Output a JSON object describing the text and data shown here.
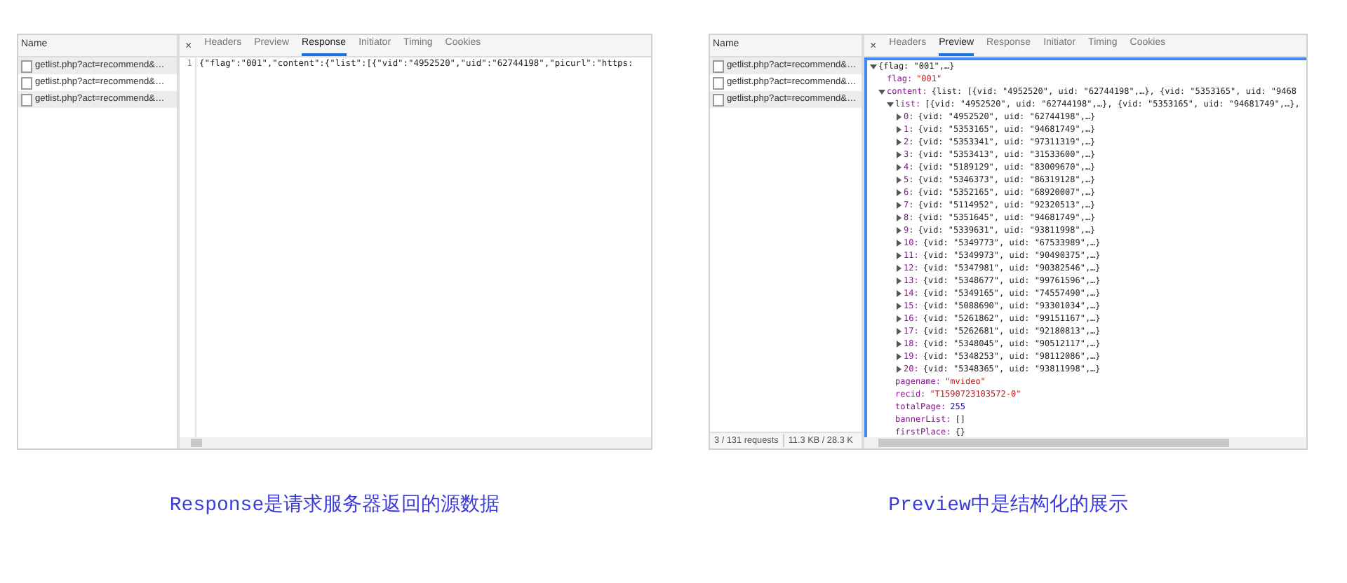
{
  "panels": [
    {
      "kind": "response",
      "list_header": "Name",
      "requests": [
        {
          "name": "getlist.php?act=recommend&…"
        },
        {
          "name": "getlist.php?act=recommend&…"
        },
        {
          "name": "getlist.php?act=recommend&…"
        }
      ],
      "close": "×",
      "tabs": [
        {
          "label": "Headers",
          "selected": false
        },
        {
          "label": "Preview",
          "selected": false
        },
        {
          "label": "Response",
          "selected": true
        },
        {
          "label": "Initiator",
          "selected": false
        },
        {
          "label": "Timing",
          "selected": false
        },
        {
          "label": "Cookies",
          "selected": false
        }
      ],
      "code_lines": [
        {
          "number": "1",
          "text": "{\"flag\":\"001\",\"content\":{\"list\":[{\"vid\":\"4952520\",\"uid\":\"62744198\",\"picurl\":\"https:"
        }
      ],
      "caption": "Response是请求服务器返回的源数据"
    },
    {
      "kind": "preview",
      "list_header": "Name",
      "requests": [
        {
          "name": "getlist.php?act=recommend&…"
        },
        {
          "name": "getlist.php?act=recommend&…"
        },
        {
          "name": "getlist.php?act=recommend&…"
        }
      ],
      "status": [
        "3 / 131 requests",
        "11.3 KB / 28.3 K"
      ],
      "close": "×",
      "tabs": [
        {
          "label": "Headers",
          "selected": false
        },
        {
          "label": "Preview",
          "selected": true
        },
        {
          "label": "Response",
          "selected": false
        },
        {
          "label": "Initiator",
          "selected": false
        },
        {
          "label": "Timing",
          "selected": false
        },
        {
          "label": "Cookies",
          "selected": false
        }
      ],
      "tree": [
        {
          "value": "{flag: \"001\",…}",
          "kind": "object",
          "expanded": true,
          "children": [
            {
              "key": "flag:",
              "value": "\"001\"",
              "kind": "string"
            },
            {
              "key": "content:",
              "value": "{list: [{vid: \"4952520\", uid: \"62744198\",…}, {vid: \"5353165\", uid: \"9468",
              "kind": "object",
              "expanded": true,
              "children": [
                {
                  "key": "list:",
                  "value": "[{vid: \"4952520\", uid: \"62744198\",…}, {vid: \"5353165\", uid: \"94681749\",…},",
                  "kind": "object",
                  "expanded": true,
                  "children": [
                    {
                      "key": "0:",
                      "value": "{vid: \"4952520\", uid: \"62744198\",…}",
                      "kind": "object",
                      "expanded": false
                    },
                    {
                      "key": "1:",
                      "value": "{vid: \"5353165\", uid: \"94681749\",…}",
                      "kind": "object",
                      "expanded": false
                    },
                    {
                      "key": "2:",
                      "value": "{vid: \"5353341\", uid: \"97311319\",…}",
                      "kind": "object",
                      "expanded": false
                    },
                    {
                      "key": "3:",
                      "value": "{vid: \"5353413\", uid: \"31533600\",…}",
                      "kind": "object",
                      "expanded": false
                    },
                    {
                      "key": "4:",
                      "value": "{vid: \"5189129\", uid: \"83009670\",…}",
                      "kind": "object",
                      "expanded": false
                    },
                    {
                      "key": "5:",
                      "value": "{vid: \"5346373\", uid: \"86319128\",…}",
                      "kind": "object",
                      "expanded": false
                    },
                    {
                      "key": "6:",
                      "value": "{vid: \"5352165\", uid: \"68920007\",…}",
                      "kind": "object",
                      "expanded": false
                    },
                    {
                      "key": "7:",
                      "value": "{vid: \"5114952\", uid: \"92320513\",…}",
                      "kind": "object",
                      "expanded": false
                    },
                    {
                      "key": "8:",
                      "value": "{vid: \"5351645\", uid: \"94681749\",…}",
                      "kind": "object",
                      "expanded": false
                    },
                    {
                      "key": "9:",
                      "value": "{vid: \"5339631\", uid: \"93811998\",…}",
                      "kind": "object",
                      "expanded": false
                    },
                    {
                      "key": "10:",
                      "value": "{vid: \"5349773\", uid: \"67533989\",…}",
                      "kind": "object",
                      "expanded": false
                    },
                    {
                      "key": "11:",
                      "value": "{vid: \"5349973\", uid: \"90490375\",…}",
                      "kind": "object",
                      "expanded": false
                    },
                    {
                      "key": "12:",
                      "value": "{vid: \"5347981\", uid: \"90382546\",…}",
                      "kind": "object",
                      "expanded": false
                    },
                    {
                      "key": "13:",
                      "value": "{vid: \"5348677\", uid: \"99761596\",…}",
                      "kind": "object",
                      "expanded": false
                    },
                    {
                      "key": "14:",
                      "value": "{vid: \"5349165\", uid: \"74557490\",…}",
                      "kind": "object",
                      "expanded": false
                    },
                    {
                      "key": "15:",
                      "value": "{vid: \"5088690\", uid: \"93301034\",…}",
                      "kind": "object",
                      "expanded": false
                    },
                    {
                      "key": "16:",
                      "value": "{vid: \"5261862\", uid: \"99151167\",…}",
                      "kind": "object",
                      "expanded": false
                    },
                    {
                      "key": "17:",
                      "value": "{vid: \"5262681\", uid: \"92180813\",…}",
                      "kind": "object",
                      "expanded": false
                    },
                    {
                      "key": "18:",
                      "value": "{vid: \"5348045\", uid: \"90512117\",…}",
                      "kind": "object",
                      "expanded": false
                    },
                    {
                      "key": "19:",
                      "value": "{vid: \"5348253\", uid: \"98112086\",…}",
                      "kind": "object",
                      "expanded": false
                    },
                    {
                      "key": "20:",
                      "value": "{vid: \"5348365\", uid: \"93811998\",…}",
                      "kind": "object",
                      "expanded": false
                    }
                  ]
                },
                {
                  "key": "pagename:",
                  "value": "\"mvideo\"",
                  "kind": "string"
                },
                {
                  "key": "recid:",
                  "value": "\"T1590723103572-0\"",
                  "kind": "string"
                },
                {
                  "key": "totalPage:",
                  "value": "255",
                  "kind": "number"
                },
                {
                  "key": "bannerList:",
                  "value": "[]",
                  "kind": "object"
                },
                {
                  "key": "firstPlace:",
                  "value": "{}",
                  "kind": "object"
                }
              ]
            }
          ]
        }
      ],
      "caption": "Preview中是结构化的展示"
    }
  ]
}
